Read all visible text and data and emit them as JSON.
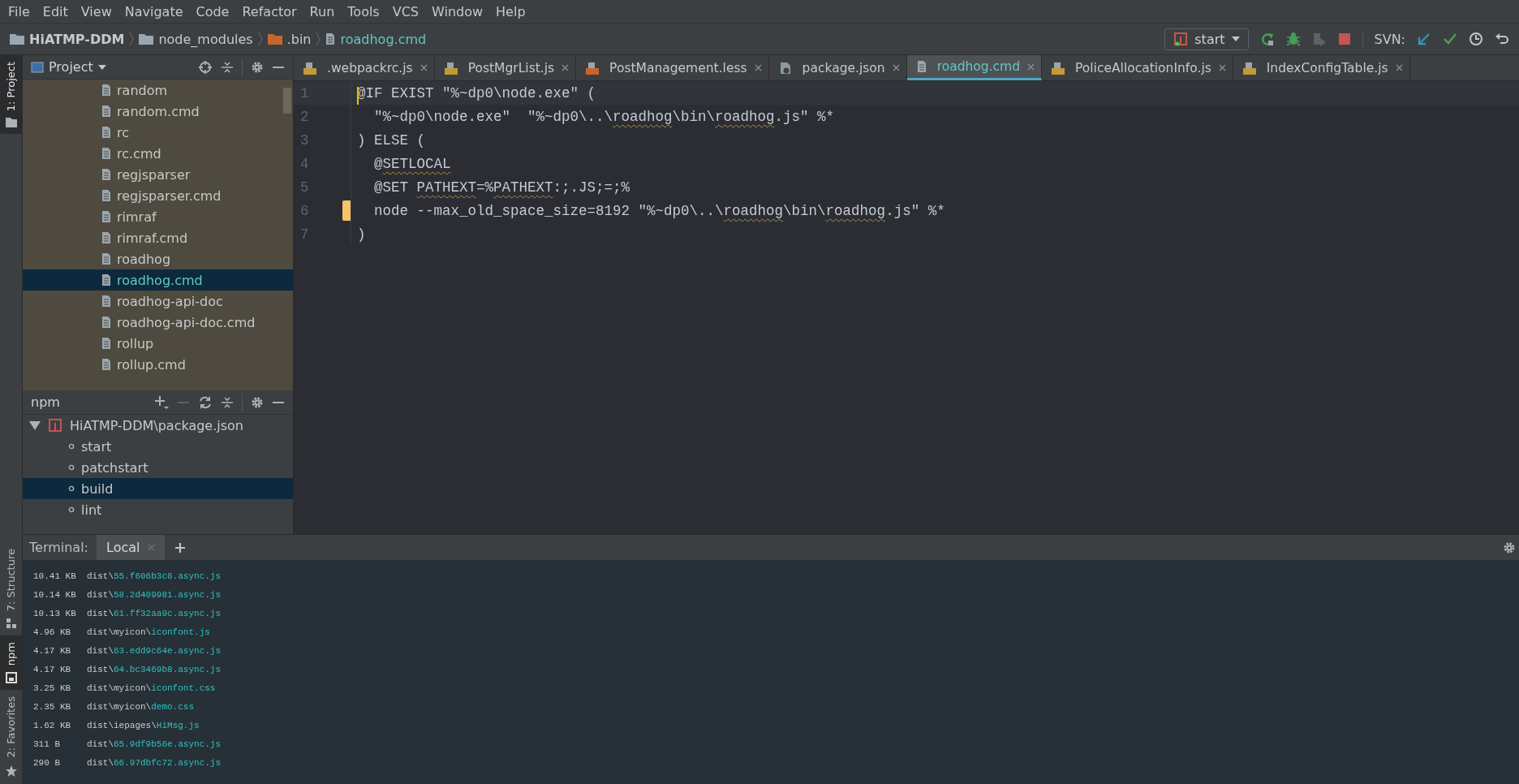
{
  "menu": [
    "File",
    "Edit",
    "View",
    "Navigate",
    "Code",
    "Refactor",
    "Run",
    "Tools",
    "VCS",
    "Window",
    "Help"
  ],
  "breadcrumb": [
    {
      "label": "HiATMP-DDM",
      "kind": "project"
    },
    {
      "label": "node_modules",
      "kind": "folder"
    },
    {
      "label": ".bin",
      "kind": "excluded"
    },
    {
      "label": "roadhog.cmd",
      "kind": "file"
    }
  ],
  "run_config": {
    "label": "start"
  },
  "svn_label": "SVN:",
  "side_tabs_top": [
    {
      "label": "1: Project",
      "kind": "project",
      "selected": true
    }
  ],
  "side_tabs_bottom": [
    {
      "label": "7: Structure",
      "kind": "structure",
      "selected": false
    },
    {
      "label": "npm",
      "kind": "npm",
      "selected": true
    },
    {
      "label": "2: Favorites",
      "kind": "favorites",
      "selected": false
    }
  ],
  "project_panel": {
    "title": "Project",
    "items": [
      {
        "label": "random",
        "selected": false
      },
      {
        "label": "random.cmd",
        "selected": false
      },
      {
        "label": "rc",
        "selected": false
      },
      {
        "label": "rc.cmd",
        "selected": false
      },
      {
        "label": "regjsparser",
        "selected": false
      },
      {
        "label": "regjsparser.cmd",
        "selected": false
      },
      {
        "label": "rimraf",
        "selected": false
      },
      {
        "label": "rimraf.cmd",
        "selected": false
      },
      {
        "label": "roadhog",
        "selected": false
      },
      {
        "label": "roadhog.cmd",
        "selected": true
      },
      {
        "label": "roadhog-api-doc",
        "selected": false
      },
      {
        "label": "roadhog-api-doc.cmd",
        "selected": false
      },
      {
        "label": "rollup",
        "selected": false
      },
      {
        "label": "rollup.cmd",
        "selected": false
      }
    ]
  },
  "npm_panel": {
    "title": "npm",
    "package": "HiATMP-DDM\\package.json",
    "expanded": true,
    "scripts": [
      {
        "label": "start",
        "selected": false
      },
      {
        "label": "patchstart",
        "selected": false
      },
      {
        "label": "build",
        "selected": true
      },
      {
        "label": "lint",
        "selected": false
      }
    ]
  },
  "tabs": [
    {
      "label": ".webpackrc.js",
      "kind": "js",
      "selected": false
    },
    {
      "label": "PostMgrList.js",
      "kind": "js",
      "selected": false
    },
    {
      "label": "PostManagement.less",
      "kind": "less",
      "selected": false
    },
    {
      "label": "package.json",
      "kind": "json",
      "selected": false
    },
    {
      "label": "roadhog.cmd",
      "kind": "cmd",
      "selected": true
    },
    {
      "label": "PoliceAllocationInfo.js",
      "kind": "js",
      "selected": false
    },
    {
      "label": "IndexConfigTable.js",
      "kind": "js",
      "selected": false
    }
  ],
  "editor": {
    "lines": [
      {
        "number": "1",
        "current": true,
        "changed": false,
        "segments": [
          {
            "text": "@IF EXIST \"%~dp0\\node.exe\" (",
            "squiggle": false
          }
        ]
      },
      {
        "number": "2",
        "current": false,
        "changed": false,
        "segments": [
          {
            "text": "  \"%~dp0\\node.exe\"  \"%~dp0\\..\\",
            "squiggle": false
          },
          {
            "text": "roadhog",
            "squiggle": true
          },
          {
            "text": "\\bin\\",
            "squiggle": false
          },
          {
            "text": "roadhog",
            "squiggle": true
          },
          {
            "text": ".js\" %*",
            "squiggle": false
          }
        ]
      },
      {
        "number": "3",
        "current": false,
        "changed": false,
        "segments": [
          {
            "text": ") ELSE (",
            "squiggle": false
          }
        ]
      },
      {
        "number": "4",
        "current": false,
        "changed": false,
        "segments": [
          {
            "text": "  @",
            "squiggle": false
          },
          {
            "text": "SETLOCAL",
            "squiggle": true
          }
        ]
      },
      {
        "number": "5",
        "current": false,
        "changed": false,
        "segments": [
          {
            "text": "  @SET ",
            "squiggle": false
          },
          {
            "text": "PATHEXT",
            "squiggle": true
          },
          {
            "text": "=%",
            "squiggle": false
          },
          {
            "text": "PATHEXT",
            "squiggle": true
          },
          {
            "text": ":;.JS;=;%",
            "squiggle": false
          }
        ]
      },
      {
        "number": "6",
        "current": false,
        "changed": true,
        "segments": [
          {
            "text": "  node --max_old_space_size=8192 \"%~dp0\\..\\",
            "squiggle": false
          },
          {
            "text": "roadhog",
            "squiggle": true
          },
          {
            "text": "\\bin\\",
            "squiggle": false
          },
          {
            "text": "roadhog",
            "squiggle": true
          },
          {
            "text": ".js\" %*",
            "squiggle": false
          }
        ]
      },
      {
        "number": "7",
        "current": false,
        "changed": false,
        "segments": [
          {
            "text": ")",
            "squiggle": false
          }
        ]
      }
    ]
  },
  "terminal": {
    "title": "Terminal:",
    "tabs": [
      {
        "label": "Local",
        "selected": true
      }
    ],
    "lines": [
      {
        "size": "10.41 KB",
        "dir": "dist\\",
        "file": "55.f606b3c8.async.js"
      },
      {
        "size": "10.14 KB",
        "dir": "dist\\",
        "file": "58.2d409981.async.js"
      },
      {
        "size": "10.13 KB",
        "dir": "dist\\",
        "file": "61.ff32aa9c.async.js"
      },
      {
        "size": "4.96 KB",
        "dir": "dist\\myicon\\",
        "file": "iconfont.js"
      },
      {
        "size": "4.17 KB",
        "dir": "dist\\",
        "file": "63.edd9c64e.async.js"
      },
      {
        "size": "4.17 KB",
        "dir": "dist\\",
        "file": "64.bc3469b8.async.js"
      },
      {
        "size": "3.25 KB",
        "dir": "dist\\myicon\\",
        "file": "iconfont.css"
      },
      {
        "size": "2.35 KB",
        "dir": "dist\\myicon\\",
        "file": "demo.css"
      },
      {
        "size": "1.62 KB",
        "dir": "dist\\iepages\\",
        "file": "HiMsg.js"
      },
      {
        "size": "311 B",
        "dir": "dist\\",
        "file": "65.9df9b56e.async.js"
      },
      {
        "size": "290 B",
        "dir": "dist\\",
        "file": "66.97dbfc72.async.js"
      }
    ]
  }
}
